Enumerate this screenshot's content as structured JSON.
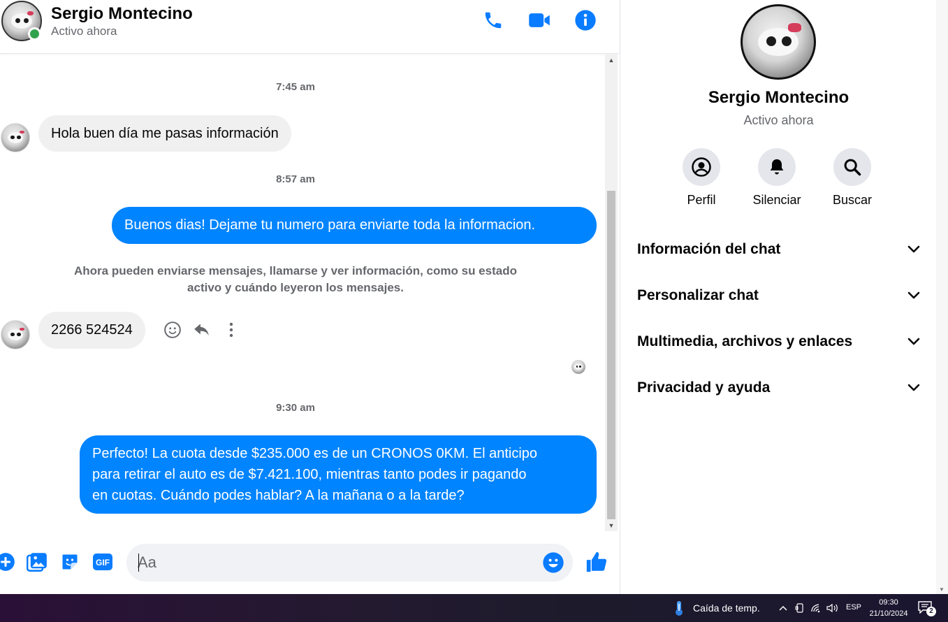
{
  "header": {
    "contact_name": "Sergio Montecino",
    "status": "Activo ahora",
    "icons": [
      "phone-icon",
      "video-camera-icon",
      "info-icon"
    ]
  },
  "conversation": {
    "timestamps": [
      "7:45 am",
      "8:57 am",
      "9:30 am"
    ],
    "messages": [
      {
        "direction": "incoming",
        "text": "Hola buen día me pasas información"
      },
      {
        "direction": "outgoing",
        "text": "Buenos dias! Dejame tu numero para enviarte toda la informacion."
      },
      {
        "direction": "incoming",
        "text": "2266 524524"
      },
      {
        "direction": "outgoing",
        "lines": [
          "Perfecto! La cuota desde $235.000 es de un CRONOS 0KM. El anticipo",
          "para retirar el auto es de $7.421.100, mientras tanto podes ir pagando",
          "en cuotas. Cuándo podes hablar? A la mañana o a la tarde?"
        ]
      }
    ],
    "system_note": {
      "line1": "Ahora pueden enviarse mensajes, llamarse y ver información, como su estado",
      "line2": "activo y cuándo leyeron los mensajes."
    },
    "message_actions": [
      "emoji-react-icon",
      "reply-icon",
      "more-options-icon"
    ]
  },
  "composer": {
    "placeholder": "Aa",
    "icons": [
      "plus-icon",
      "photo-icon",
      "sticker-icon",
      "gif-icon",
      "emoji-icon",
      "thumbs-up-icon"
    ],
    "gif_label": "GIF"
  },
  "info_panel": {
    "name": "Sergio Montecino",
    "status": "Activo ahora",
    "quick_actions": [
      {
        "label": "Perfil",
        "icon": "profile-icon"
      },
      {
        "label": "Silenciar",
        "icon": "bell-icon"
      },
      {
        "label": "Buscar",
        "icon": "search-icon"
      }
    ],
    "sections": [
      {
        "title": "Información del chat"
      },
      {
        "title": "Personalizar chat"
      },
      {
        "title": "Multimedia, archivos y enlaces"
      },
      {
        "title": "Privacidad y ayuda"
      }
    ]
  },
  "taskbar": {
    "weather_text": "Caída de temp.",
    "language": "ESP",
    "time": "09:30",
    "date": "21/10/2024",
    "notification_count": "2"
  },
  "colors": {
    "accent": "#0084ff",
    "icon_blue": "#0a7cff",
    "online": "#31a24c",
    "incoming_bubble": "#f0f0f0",
    "muted_text": "#65676b"
  }
}
